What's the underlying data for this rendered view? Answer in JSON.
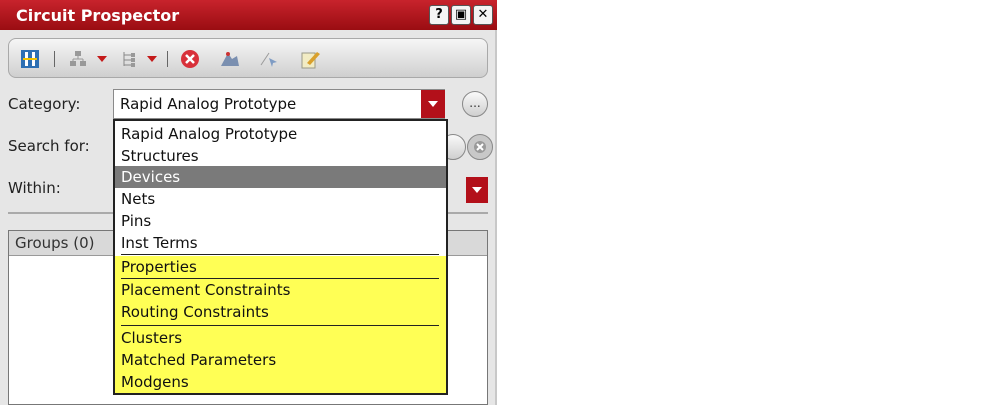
{
  "window": {
    "title": "Circuit Prospector",
    "controls": [
      "?",
      "▣",
      "✕"
    ]
  },
  "toolbar": {
    "icons": [
      "navigator-icon",
      "hierarchy-icon",
      "dropdown-icon",
      "tree-icon",
      "dropdown-icon",
      "stop-icon",
      "probe-icon",
      "select-icon",
      "edit-icon"
    ]
  },
  "category": {
    "label": "Category:",
    "value": "Rapid Analog Prototype",
    "more": "..."
  },
  "search": {
    "label": "Search for:"
  },
  "within": {
    "label": "Within:"
  },
  "groups": {
    "label": "Groups (0)"
  },
  "dropdown": {
    "items": [
      {
        "label": "Rapid Analog Prototype",
        "style": "plain"
      },
      {
        "label": "Structures",
        "style": "plain"
      },
      {
        "label": "Devices",
        "style": "selected"
      },
      {
        "label": "Nets",
        "style": "plain"
      },
      {
        "label": "Pins",
        "style": "plain"
      },
      {
        "label": "Inst Terms",
        "style": "plain"
      },
      {
        "label": "Properties",
        "style": "highlight"
      },
      {
        "label": "Placement Constraints",
        "style": "highlight"
      },
      {
        "label": "Routing Constraints",
        "style": "highlight"
      },
      {
        "label": "Clusters",
        "style": "highlight"
      },
      {
        "label": "Matched Parameters",
        "style": "highlight"
      },
      {
        "label": "Modgens",
        "style": "highlight"
      }
    ]
  },
  "colors": {
    "titlebar": "#b3101a",
    "highlight": "#ffff55",
    "selected": "#7a7a7a"
  }
}
